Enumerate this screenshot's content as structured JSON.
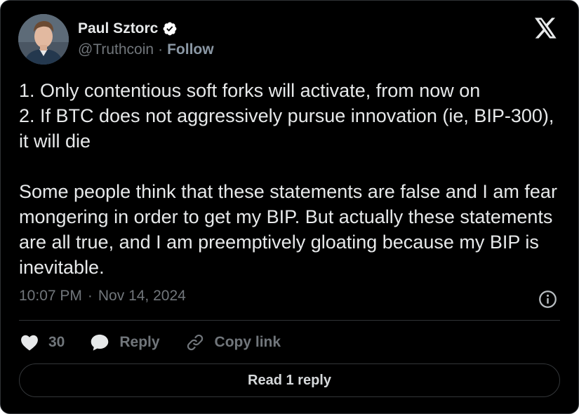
{
  "author": {
    "name": "Paul Sztorc",
    "handle": "@Truthcoin",
    "separator": "·",
    "follow_label": "Follow",
    "verified": true,
    "avatar_icon": "person-avatar"
  },
  "platform_icon": "x-logo-icon",
  "tweet": {
    "text": "1. Only contentious soft forks will activate, from now on\n2. If BTC does not aggressively pursue innovation (ie, BIP-300), it will die\n\nSome people think that these statements are false and I am fear mongering in order to get my BIP. But actually these statements are all true, and I am preemptively gloating because my BIP is inevitable."
  },
  "meta": {
    "time": "10:07 PM",
    "separator": "·",
    "date": "Nov 14, 2024"
  },
  "actions": {
    "likes_count": "30",
    "reply_label": "Reply",
    "copy_link_label": "Copy link"
  },
  "read_replies_label": "Read 1 reply",
  "colors": {
    "background": "#000000",
    "text_primary": "#e7e9ea",
    "text_secondary": "#71767b",
    "border": "#2f3336",
    "verified_badge": "#ffffff"
  }
}
